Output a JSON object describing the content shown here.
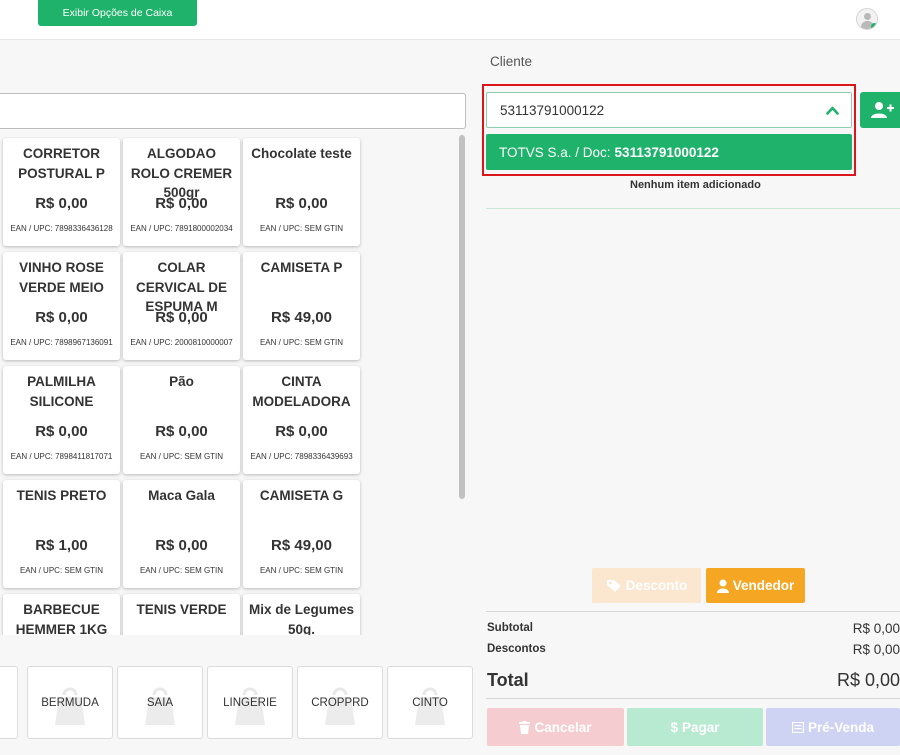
{
  "topbar": {
    "caixa_button": "Exibir Opções de Caixa",
    "avatar_icon": "user-avatar-icon"
  },
  "products": [
    {
      "name": "CORRETOR POSTURAL P",
      "price": "R$ 0,00",
      "ean": "EAN / UPC: 7898336436128"
    },
    {
      "name": "ALGODAO ROLO CREMER 500gr",
      "price": "R$ 0,00",
      "ean": "EAN / UPC: 7891800002034"
    },
    {
      "name": "Chocolate teste",
      "price": "R$ 0,00",
      "ean": "EAN / UPC: SEM GTIN"
    },
    {
      "name": "VINHO ROSE VERDE MEIO",
      "price": "R$ 0,00",
      "ean": "EAN / UPC: 7898967136091"
    },
    {
      "name": "COLAR CERVICAL DE ESPUMA M",
      "price": "R$ 0,00",
      "ean": "EAN / UPC: 2000810000007"
    },
    {
      "name": "CAMISETA P",
      "price": "R$ 49,00",
      "ean": "EAN / UPC: SEM GTIN"
    },
    {
      "name": "PALMILHA SILICONE",
      "price": "R$ 0,00",
      "ean": "EAN / UPC: 7898411817071"
    },
    {
      "name": "Pão",
      "price": "R$ 0,00",
      "ean": "EAN / UPC: SEM GTIN"
    },
    {
      "name": "CINTA MODELADORA",
      "price": "R$ 0,00",
      "ean": "EAN / UPC: 7898336439693"
    },
    {
      "name": "TENIS PRETO",
      "price": "R$ 1,00",
      "ean": "EAN / UPC: SEM GTIN"
    },
    {
      "name": "Maca Gala",
      "price": "R$ 0,00",
      "ean": "EAN / UPC: SEM GTIN"
    },
    {
      "name": "CAMISETA G",
      "price": "R$ 49,00",
      "ean": "EAN / UPC: SEM GTIN"
    },
    {
      "name": "BARBECUE HEMMER 1KG",
      "price": "",
      "ean": ""
    },
    {
      "name": "TENIS VERDE",
      "price": "",
      "ean": ""
    },
    {
      "name": "Mix de Legumes 50g.",
      "price": "",
      "ean": ""
    }
  ],
  "categories": [
    "BERMUDA",
    "SAIA",
    "LINGERIE",
    "CROPPRD",
    "CINTO"
  ],
  "client": {
    "label": "Cliente",
    "input_value": "53113791000122",
    "suggestion_name": "TOTVS S.a. / Doc:",
    "suggestion_doc": "53113791000122",
    "empty_message": "Nenhum item adicionado"
  },
  "actions": {
    "desconto": "Desconto",
    "vendedor": "Vendedor"
  },
  "summary": {
    "subtotal_label": "Subtotal",
    "subtotal_value": "R$ 0,00",
    "descontos_label": "Descontos",
    "descontos_value": "R$ 0,00",
    "total_label": "Total",
    "total_value": "R$ 0,00"
  },
  "footer": {
    "cancelar": "Cancelar",
    "pagar": "Pagar",
    "pre_venda": "Pré-Venda"
  },
  "colors": {
    "primary_green": "#1fb26b",
    "orange": "#f5a623",
    "highlight_red": "#d9161b"
  }
}
